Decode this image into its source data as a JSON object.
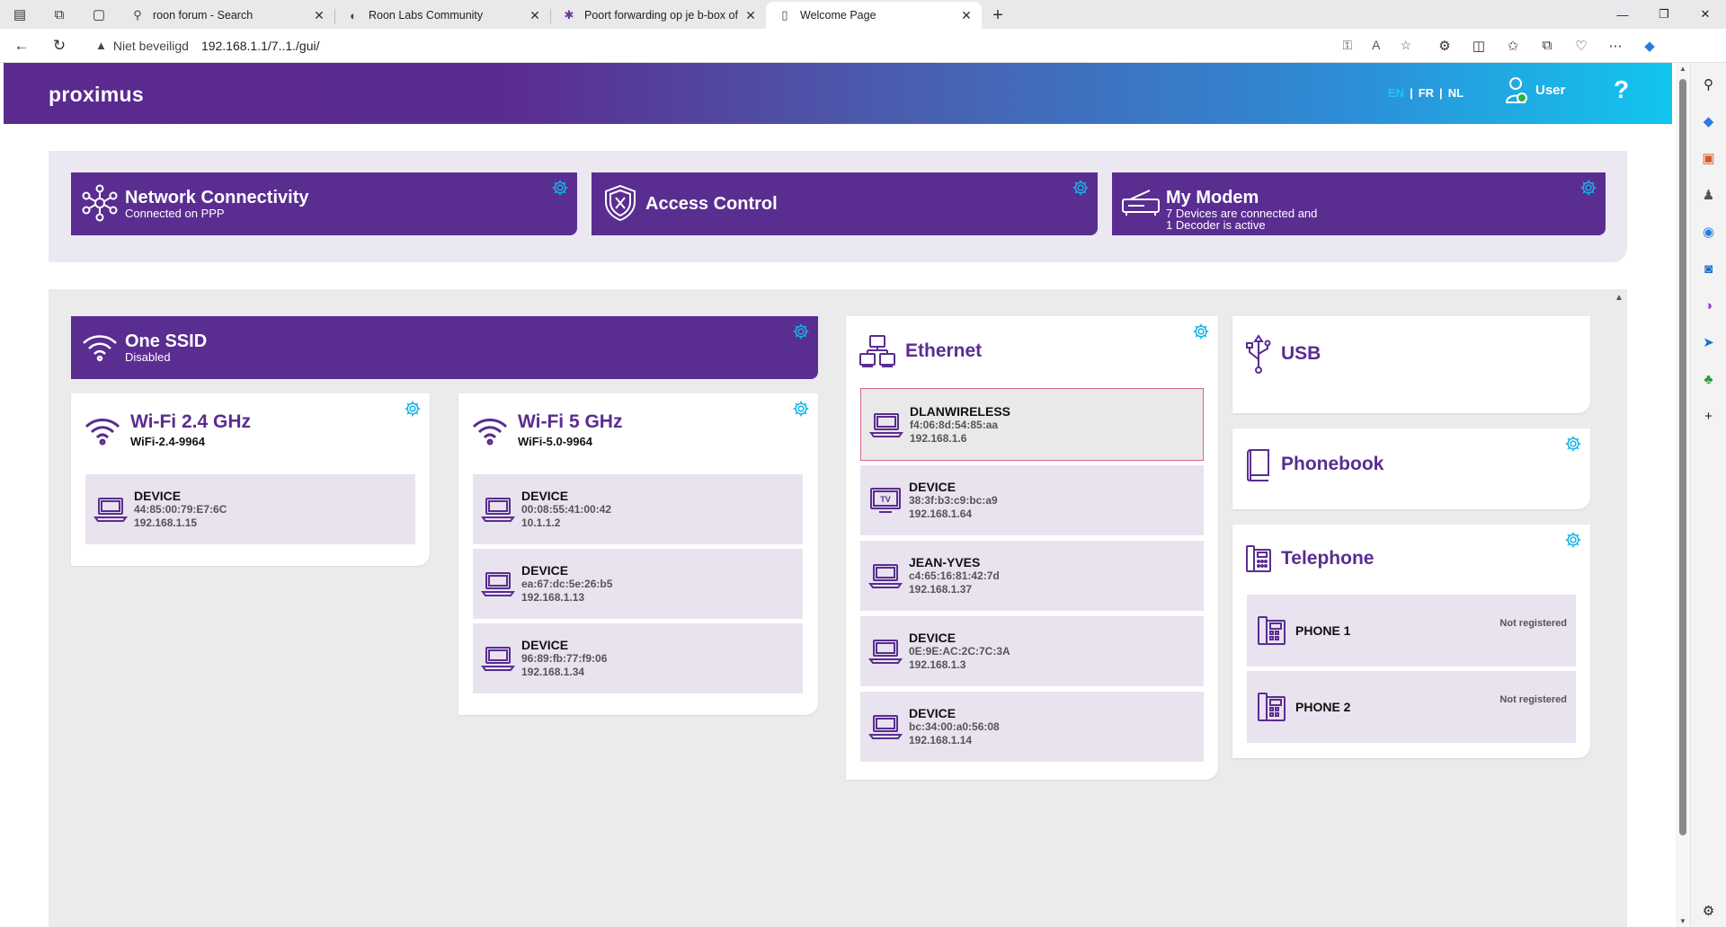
{
  "browser": {
    "tabs": [
      {
        "title": "roon forum - Search",
        "icon": "search-icon"
      },
      {
        "title": "Roon Labs Community",
        "icon": "roon-icon"
      },
      {
        "title": "Poort forwarding op je b-box of",
        "icon": "proximus-icon"
      },
      {
        "title": "Welcome Page",
        "icon": "page-icon",
        "active": true
      }
    ],
    "security_label": "Niet beveiligd",
    "url": "192.168.1.1/7..1./gui/"
  },
  "header": {
    "logo": "proximus",
    "languages": [
      "EN",
      "FR",
      "NL"
    ],
    "active_language": "EN",
    "user_label": "User",
    "help": "?"
  },
  "tiles": [
    {
      "title": "Network Connectivity",
      "subtitle": "Connected on PPP"
    },
    {
      "title": "Access Control",
      "subtitle": ""
    },
    {
      "title": "My Modem",
      "subtitle_line1": "7 Devices are connected and",
      "subtitle_line2": "1 Decoder is active"
    }
  ],
  "one_ssid": {
    "title": "One SSID",
    "subtitle": "Disabled"
  },
  "wifi24": {
    "title": "Wi-Fi 2.4 GHz",
    "ssid": "WiFi-2.4-9964",
    "devices": [
      {
        "name": "DEVICE",
        "mac": "44:85:00:79:E7:6C",
        "ip": "192.168.1.15"
      }
    ]
  },
  "wifi5": {
    "title": "Wi-Fi 5 GHz",
    "ssid": "WiFi-5.0-9964",
    "devices": [
      {
        "name": "DEVICE",
        "mac": "00:08:55:41:00:42",
        "ip": "10.1.1.2"
      },
      {
        "name": "DEVICE",
        "mac": "ea:67:dc:5e:26:b5",
        "ip": "192.168.1.13"
      },
      {
        "name": "DEVICE",
        "mac": "96:89:fb:77:f9:06",
        "ip": "192.168.1.34"
      }
    ]
  },
  "ethernet": {
    "title": "Ethernet",
    "devices": [
      {
        "name": "DLANWIRELESS",
        "mac": "f4:06:8d:54:85:aa",
        "ip": "192.168.1.6",
        "type": "laptop"
      },
      {
        "name": "DEVICE",
        "mac": "38:3f:b3:c9:bc:a9",
        "ip": "192.168.1.64",
        "type": "tv",
        "tv_label": "TV"
      },
      {
        "name": "JEAN-YVES",
        "mac": "c4:65:16:81:42:7d",
        "ip": "192.168.1.37",
        "type": "laptop"
      },
      {
        "name": "DEVICE",
        "mac": "0E:9E:AC:2C:7C:3A",
        "ip": "192.168.1.3",
        "type": "laptop"
      },
      {
        "name": "DEVICE",
        "mac": "bc:34:00:a0:56:08",
        "ip": "192.168.1.14",
        "type": "laptop"
      }
    ]
  },
  "usb": {
    "title": "USB"
  },
  "phonebook": {
    "title": "Phonebook"
  },
  "telephone": {
    "title": "Telephone",
    "phones": [
      {
        "name": "PHONE 1",
        "status": "Not registered"
      },
      {
        "name": "PHONE 2",
        "status": "Not registered"
      }
    ]
  },
  "colors": {
    "brand_purple": "#5a2d91",
    "accent_cyan": "#12b4e6",
    "selected_border": "#d86a7e"
  }
}
